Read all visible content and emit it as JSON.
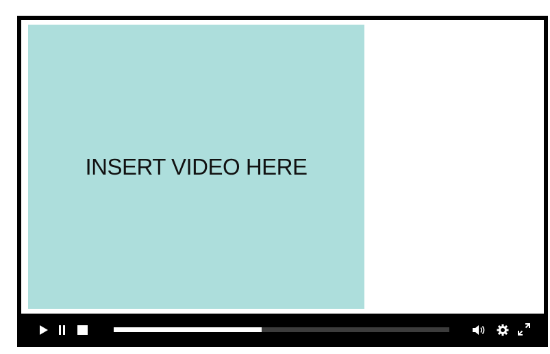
{
  "player": {
    "placeholder_text": "INSERT VIDEO HERE",
    "video_background_color": "#addedc",
    "frame_color": "#000000",
    "controls": {
      "play_icon": "play-icon",
      "pause_icon": "pause-icon",
      "stop_icon": "stop-icon",
      "volume_icon": "volume-icon",
      "settings_icon": "gear-icon",
      "fullscreen_icon": "fullscreen-icon",
      "progress": 0.44,
      "progress_fill_color": "#ffffff",
      "progress_track_color": "#3c3c3c"
    }
  }
}
